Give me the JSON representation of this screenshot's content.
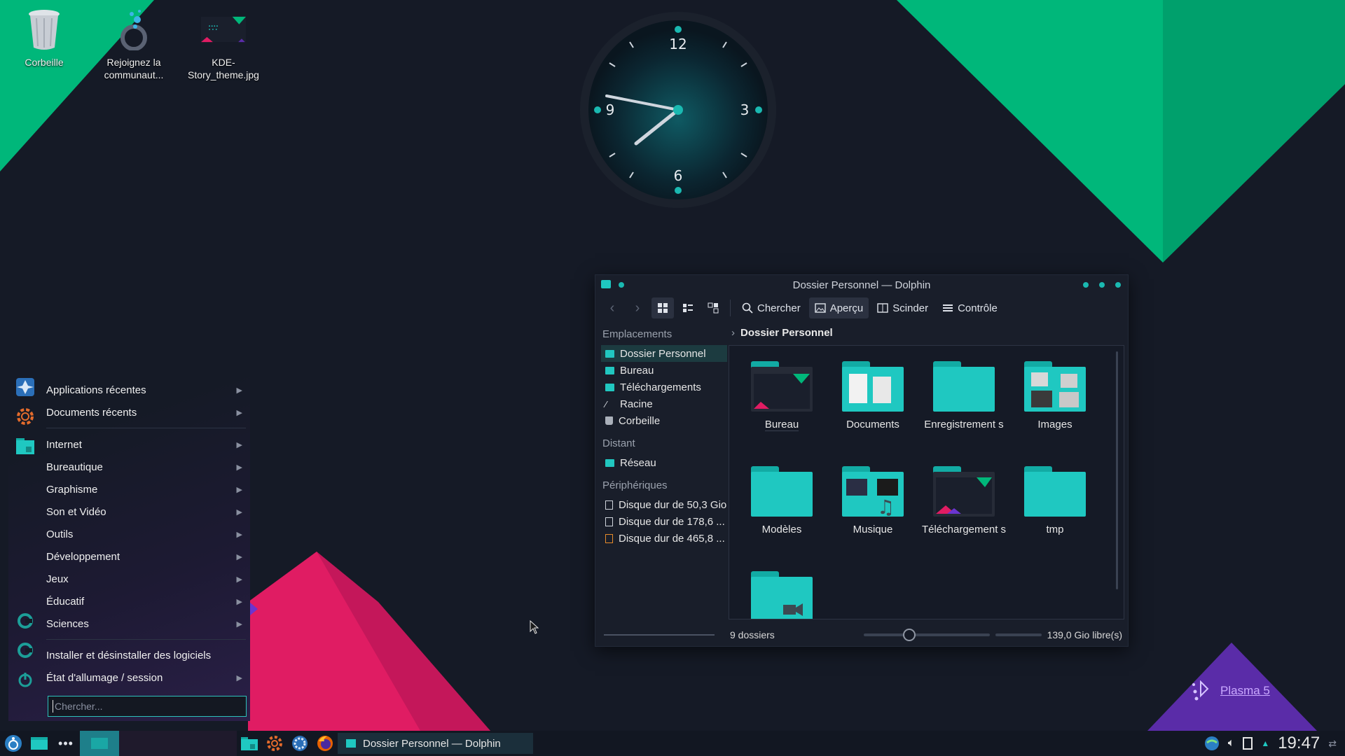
{
  "colors": {
    "accent": "#1fc8c1",
    "green": "#00b77a",
    "pink": "#e01c63",
    "purple": "#5a2ca8",
    "bg": "#151a26"
  },
  "desktop": {
    "icons": [
      {
        "label": "Corbeille",
        "icon": "trash-icon"
      },
      {
        "label": "Rejoignez la communaut...",
        "icon": "community-icon"
      },
      {
        "label": "KDE-Story_theme.jpg",
        "icon": "image-thumbnail-icon"
      }
    ],
    "clock": {
      "numerals": [
        "12",
        "3",
        "6",
        "9"
      ],
      "time": "19:47"
    },
    "plasma_logo": "Plasma 5"
  },
  "dolphin": {
    "title": "Dossier Personnel — Dolphin",
    "toolbar": {
      "search": "Chercher",
      "preview": "Aperçu",
      "split": "Scinder",
      "control": "Contrôle"
    },
    "sidebar": {
      "places_title": "Emplacements",
      "places": [
        "Dossier Personnel",
        "Bureau",
        "Téléchargements",
        "Racine",
        "Corbeille"
      ],
      "remote_title": "Distant",
      "remote": [
        "Réseau"
      ],
      "devices_title": "Périphériques",
      "devices": [
        "Disque dur de 50,3 Gio",
        "Disque dur de 178,6 ...",
        "Disque dur de 465,8 ..."
      ]
    },
    "breadcrumb": "Dossier Personnel",
    "folders": [
      "Bureau",
      "Documents",
      "Enregistrement s",
      "Images",
      "Modèles",
      "Musique",
      "Téléchargement s",
      "tmp",
      ""
    ],
    "status": {
      "count": "9 dossiers",
      "free": "139,0 Gio libre(s)",
      "zoom": 0.35
    }
  },
  "launcher": {
    "items_top": [
      "Applications récentes",
      "Documents récents"
    ],
    "categories": [
      "Internet",
      "Bureautique",
      "Graphisme",
      "Son et Vidéo",
      "Outils",
      "Développement",
      "Jeux",
      "Éducatif",
      "Sciences"
    ],
    "items_bottom": [
      "Installer et désinstaller des logiciels",
      "État d'allumage / session"
    ],
    "search_placeholder": "Chercher..."
  },
  "taskbar": {
    "task_title": "Dossier Personnel — Dolphin",
    "time": "19:47"
  }
}
